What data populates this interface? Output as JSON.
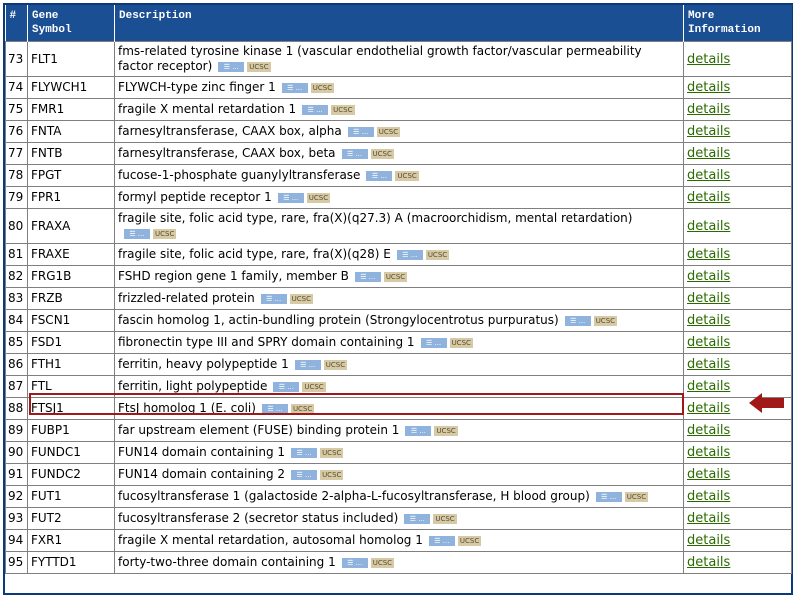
{
  "header": {
    "col_num": "#",
    "col_gene_line1": "Gene",
    "col_gene_line2": "Symbol",
    "col_desc": "Description",
    "col_more_line1": "More",
    "col_more_line2": "Information"
  },
  "badges": {
    "blue": "☰ ...",
    "tan": "UCSC"
  },
  "highlighted_row": 87,
  "colors": {
    "header_bg": "#1b4f94",
    "highlight": "#a01818",
    "link": "#2a6b00"
  },
  "rows": [
    {
      "num": "73",
      "symbol": "FLT1",
      "desc": "fms-related tyrosine kinase 1 (vascular endothelial growth factor/vascular permeability factor receptor)",
      "more": "details",
      "tall": true
    },
    {
      "num": "74",
      "symbol": "FLYWCH1",
      "desc": "FLYWCH-type zinc finger 1",
      "more": "details"
    },
    {
      "num": "75",
      "symbol": "FMR1",
      "desc": "fragile X mental retardation 1",
      "more": "details"
    },
    {
      "num": "76",
      "symbol": "FNTA",
      "desc": "farnesyltransferase, CAAX box, alpha",
      "more": "details"
    },
    {
      "num": "77",
      "symbol": "FNTB",
      "desc": "farnesyltransferase, CAAX box, beta",
      "more": "details"
    },
    {
      "num": "78",
      "symbol": "FPGT",
      "desc": "fucose-1-phosphate guanylyltransferase",
      "more": "details"
    },
    {
      "num": "79",
      "symbol": "FPR1",
      "desc": "formyl peptide receptor 1",
      "more": "details"
    },
    {
      "num": "80",
      "symbol": "FRAXA",
      "desc": "fragile site, folic acid type, rare, fra(X)(q27.3) A (macroorchidism, mental retardation)",
      "more": "details",
      "tall": true
    },
    {
      "num": "81",
      "symbol": "FRAXE",
      "desc": "fragile site, folic acid type, rare, fra(X)(q28) E",
      "more": "details"
    },
    {
      "num": "82",
      "symbol": "FRG1B",
      "desc": "FSHD region gene 1 family, member B",
      "more": "details"
    },
    {
      "num": "83",
      "symbol": "FRZB",
      "desc": "frizzled-related protein",
      "more": "details"
    },
    {
      "num": "84",
      "symbol": "FSCN1",
      "desc": "fascin homolog 1, actin-bundling protein (Strongylocentrotus purpuratus)",
      "more": "details"
    },
    {
      "num": "85",
      "symbol": "FSD1",
      "desc": "fibronectin type III and SPRY domain containing 1",
      "more": "details"
    },
    {
      "num": "86",
      "symbol": "FTH1",
      "desc": "ferritin, heavy polypeptide 1",
      "more": "details"
    },
    {
      "num": "87",
      "symbol": "FTL",
      "desc": "ferritin, light polypeptide",
      "more": "details"
    },
    {
      "num": "88",
      "symbol": "FTSJ1",
      "desc": "FtsJ homolog 1 (E. coli)",
      "more": "details"
    },
    {
      "num": "89",
      "symbol": "FUBP1",
      "desc": "far upstream element (FUSE) binding protein 1",
      "more": "details"
    },
    {
      "num": "90",
      "symbol": "FUNDC1",
      "desc": "FUN14 domain containing 1",
      "more": "details"
    },
    {
      "num": "91",
      "symbol": "FUNDC2",
      "desc": "FUN14 domain containing 2",
      "more": "details"
    },
    {
      "num": "92",
      "symbol": "FUT1",
      "desc": "fucosyltransferase 1 (galactoside 2-alpha-L-fucosyltransferase, H blood group)",
      "more": "details"
    },
    {
      "num": "93",
      "symbol": "FUT2",
      "desc": "fucosyltransferase 2 (secretor status included)",
      "more": "details"
    },
    {
      "num": "94",
      "symbol": "FXR1",
      "desc": "fragile X mental retardation, autosomal homolog 1",
      "more": "details"
    },
    {
      "num": "95",
      "symbol": "FYTTD1",
      "desc": "forty-two-three domain containing 1",
      "more": "details"
    }
  ]
}
